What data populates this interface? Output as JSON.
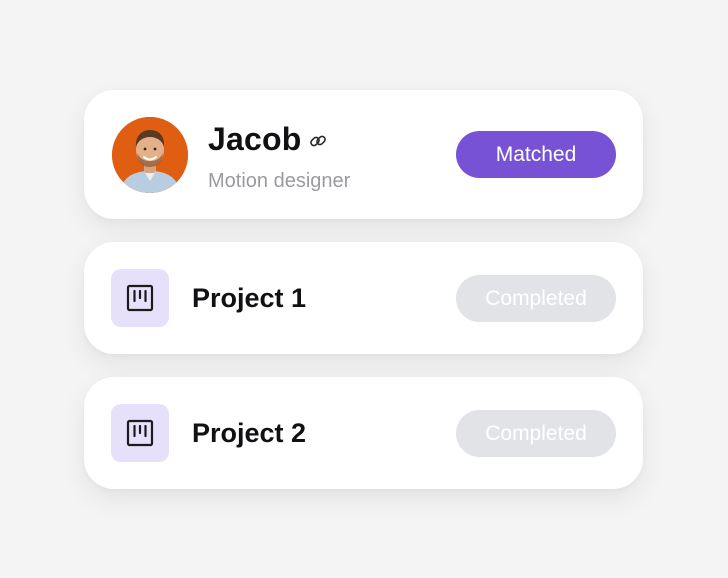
{
  "profile": {
    "name": "Jacob",
    "role": "Motion designer",
    "status": "Matched",
    "avatar_bg": "#e05e12",
    "link_icon": "link-icon"
  },
  "projects": [
    {
      "title": "Project 1",
      "status": "Completed",
      "icon": "kanban-board-icon"
    },
    {
      "title": "Project 2",
      "status": "Completed",
      "icon": "kanban-board-icon"
    }
  ],
  "colors": {
    "accent": "#7752d4",
    "completed_bg": "#e1e3e6",
    "icon_tile_bg": "#e6e0fa",
    "background": "#f4f4f5"
  }
}
